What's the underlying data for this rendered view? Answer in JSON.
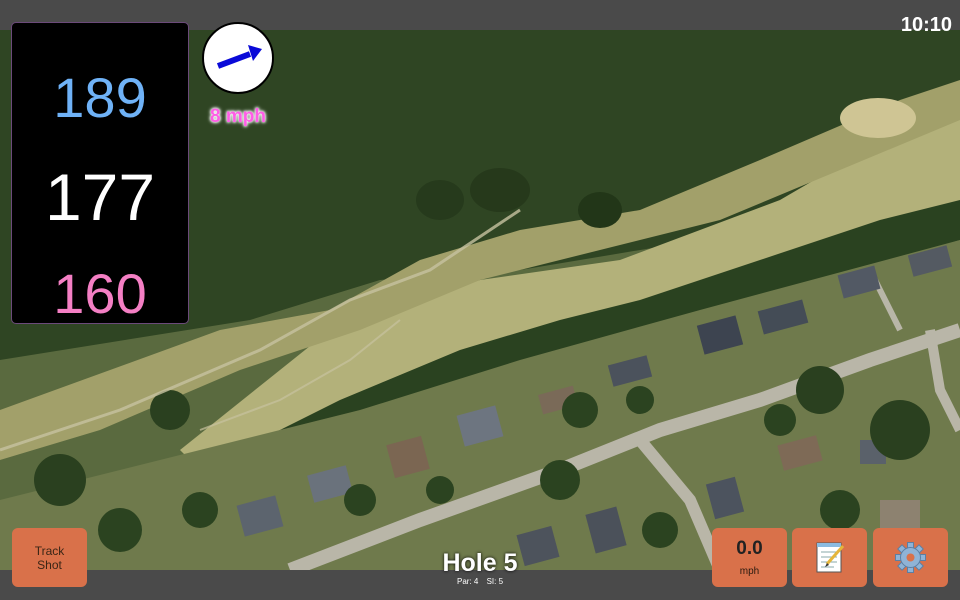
{
  "status": {
    "time": "10:10"
  },
  "yardages": {
    "back": "189",
    "middle": "177",
    "front": "160"
  },
  "wind": {
    "speed": "8 mph",
    "icon": "wind-direction-arrow-icon"
  },
  "hole": {
    "title": "Hole 5",
    "par": "Par: 4",
    "stroke_index": "SI: 5"
  },
  "buttons": {
    "track_line1": "Track",
    "track_line2": "Shot",
    "speed_value": "0.0",
    "speed_unit": "mph",
    "notes_icon": "notepad-icon",
    "settings_icon": "gear-icon"
  },
  "colors": {
    "back": "#6fb2f7",
    "middle": "#ffffff",
    "front": "#f47fc4",
    "wind_text": "#ff5de6",
    "button": "#d9714a"
  }
}
